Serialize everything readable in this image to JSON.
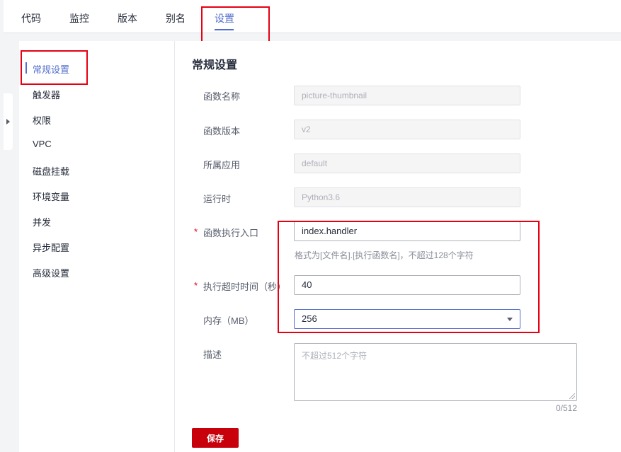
{
  "tabs": [
    {
      "label": "代码"
    },
    {
      "label": "监控"
    },
    {
      "label": "版本"
    },
    {
      "label": "别名"
    },
    {
      "label": "设置"
    }
  ],
  "sidebar": {
    "items": [
      {
        "label": "常规设置"
      },
      {
        "label": "触发器"
      },
      {
        "label": "权限"
      },
      {
        "label": "VPC"
      },
      {
        "label": "磁盘挂载"
      },
      {
        "label": "环境变量"
      },
      {
        "label": "并发"
      },
      {
        "label": "异步配置"
      },
      {
        "label": "高级设置"
      }
    ]
  },
  "section": {
    "title": "常规设置"
  },
  "form": {
    "function_name": {
      "label": "函数名称",
      "value": "picture-thumbnail"
    },
    "function_version": {
      "label": "函数版本",
      "value": "v2"
    },
    "app": {
      "label": "所属应用",
      "value": "default"
    },
    "runtime": {
      "label": "运行时",
      "value": "Python3.6"
    },
    "handler": {
      "label": "函数执行入口",
      "value": "index.handler",
      "hint": "格式为[文件名].[执行函数名]，不超过128个字符",
      "required_mark": "*"
    },
    "timeout": {
      "label": "执行超时时间（秒）",
      "value": "40",
      "required_mark": "*"
    },
    "memory": {
      "label": "内存（MB）",
      "value": "256"
    },
    "description": {
      "label": "描述",
      "placeholder": "不超过512个字符",
      "counter": "0/512"
    }
  },
  "save_button": {
    "label": "保存"
  },
  "colors": {
    "accent": "#526ecc",
    "primary_button": "#c7000b",
    "annotation": "#e60012"
  }
}
